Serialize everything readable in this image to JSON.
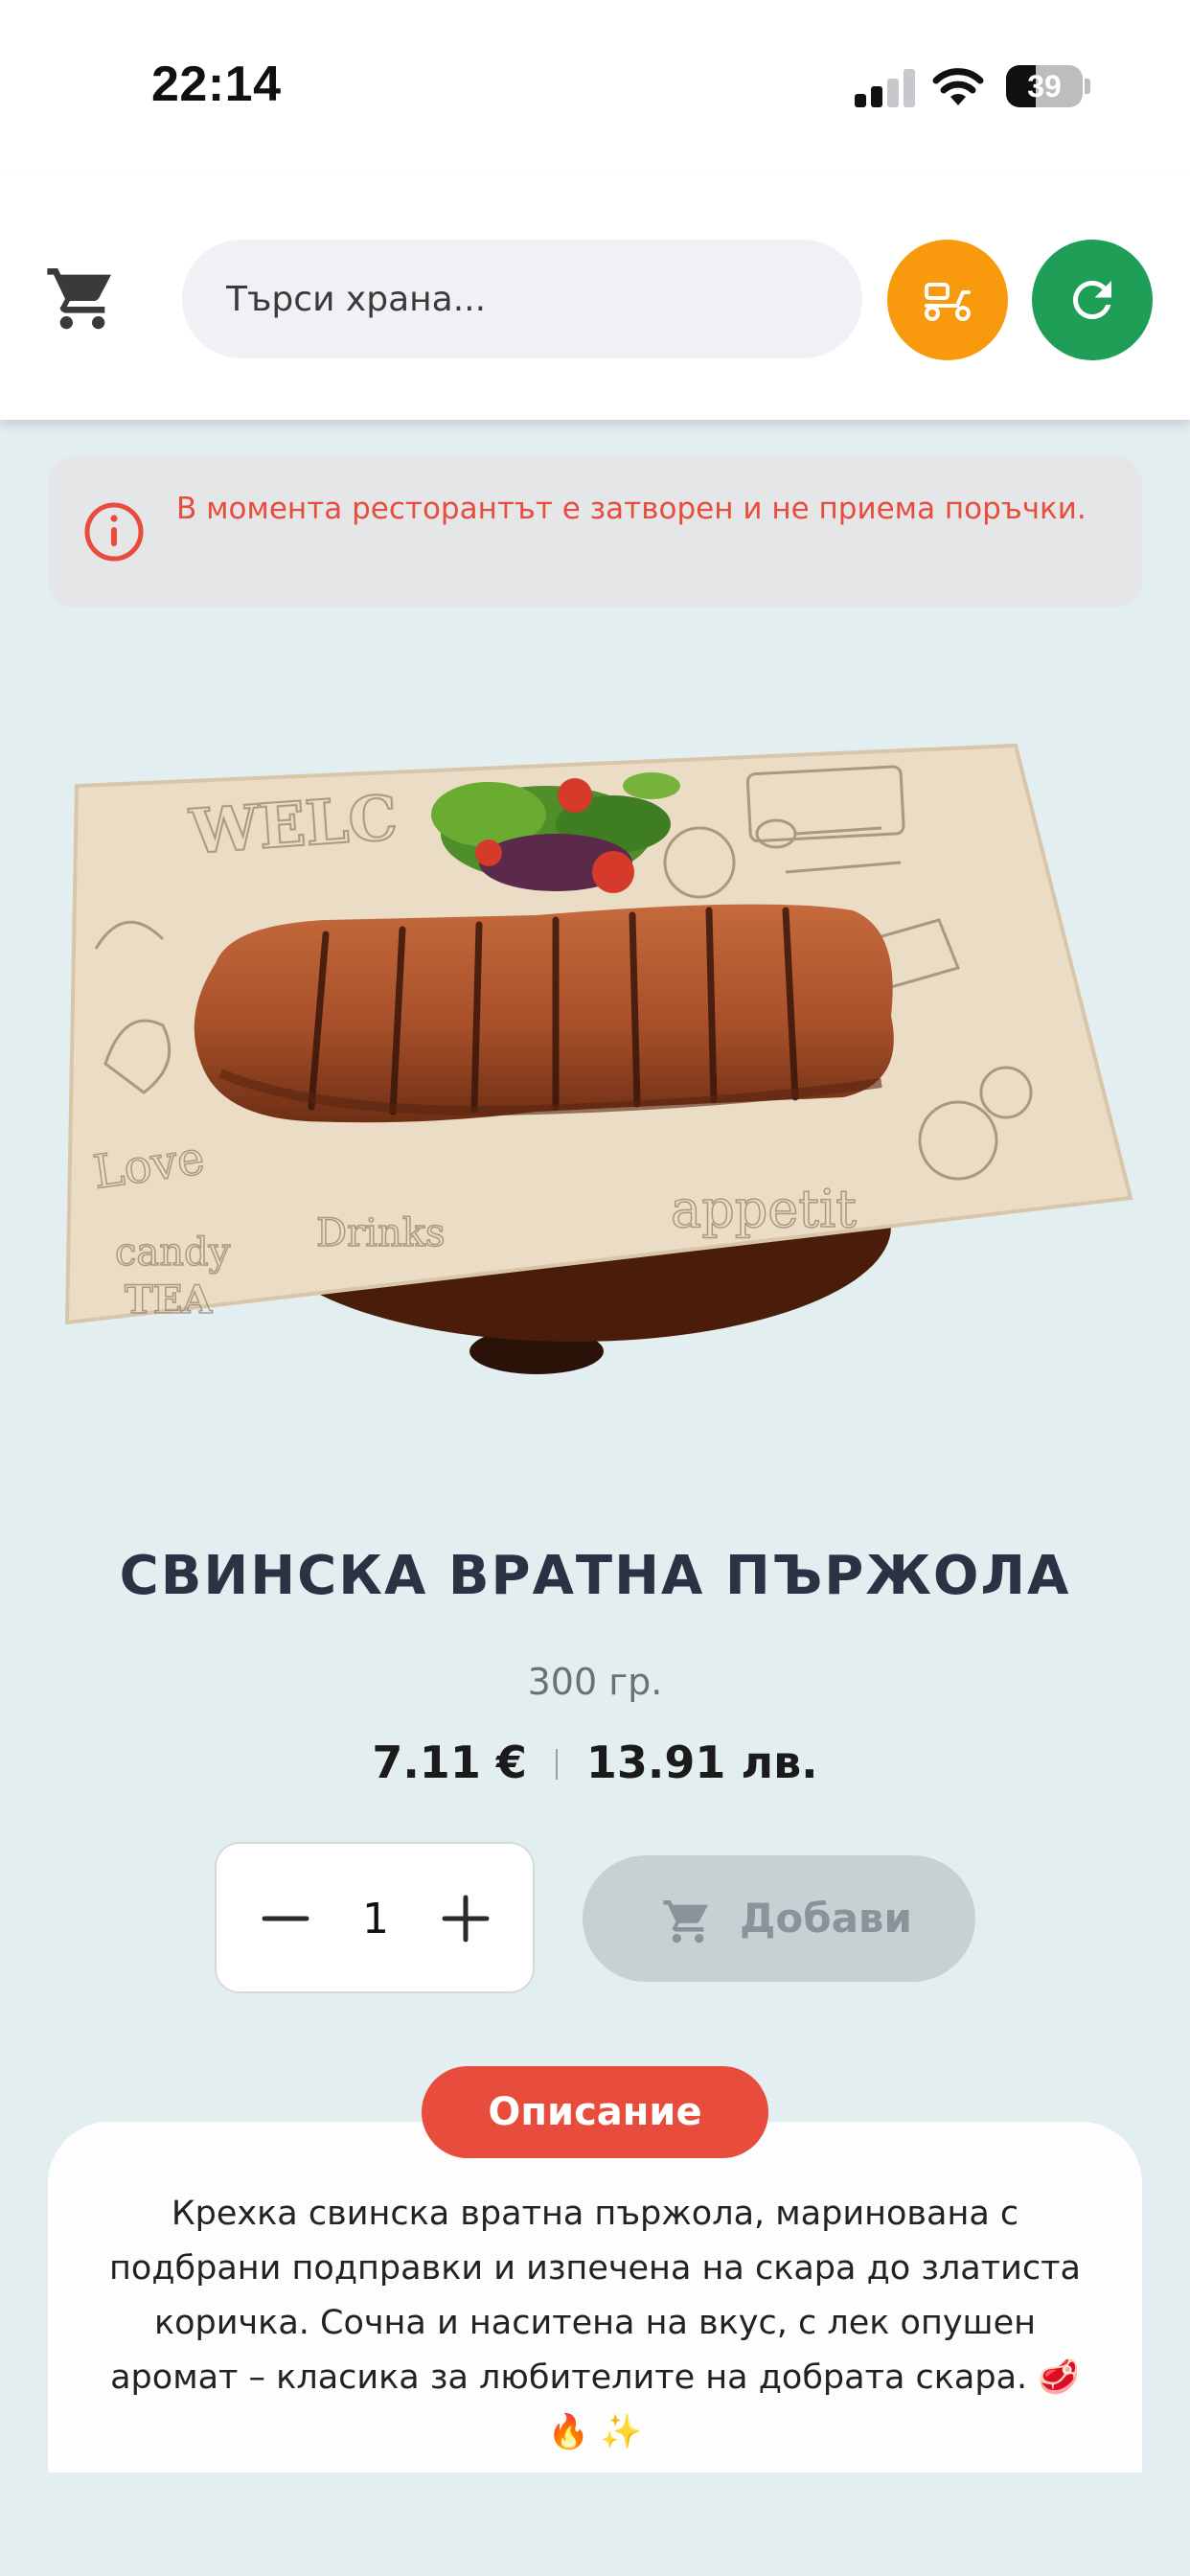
{
  "status_bar": {
    "time": "22:14",
    "battery": "39",
    "battery_level": 0.39,
    "signal_icon": "cellular-signal-icon",
    "wifi_icon": "wifi-icon"
  },
  "header": {
    "cart_icon": "shopping-cart-icon",
    "search": {
      "placeholder": "Търси храна..."
    },
    "delivery_icon": "scooter-delivery-icon",
    "refresh_icon": "refresh-icon",
    "colors": {
      "delivery": "#F99A0E",
      "refresh": "#1E9E57"
    }
  },
  "alert": {
    "icon": "info-circle-icon",
    "text": "В момента ресторантът е затворен и не приема поръчки.",
    "color": "#E74C3C"
  },
  "product": {
    "image_alt": "grilled pork steak on wooden board with salad",
    "title": "СВИНСКА ВРАТНА ПЪРЖОЛА",
    "weight": "300 гр.",
    "price_eur": "7.11 €",
    "price_bgn": "13.91 лв.",
    "quantity": "1",
    "add_label": "Добави",
    "add_icon": "cart-icon"
  },
  "description": {
    "label": "Описание",
    "text": "Крехка свинска вратна пържола, маринована с подбрани подправки и изпечена на скара до златиста коричка. Сочна и наситена на вкус, с лек опушен аромат – класика за любителите на добрата скара. 🥩 🔥 ✨"
  }
}
